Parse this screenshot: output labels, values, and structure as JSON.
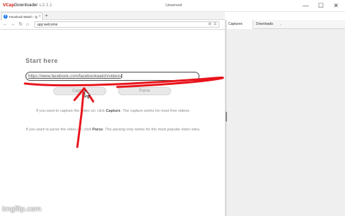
{
  "titlebar": {
    "logo_red": "VCap",
    "logo_rest": "Downloader",
    "version": "v.2.1.1",
    "center_text": "Unserved",
    "minimize_glyph": "—",
    "maximize_glyph": "☐",
    "close_glyph": "✕"
  },
  "tab": {
    "favicon": "f",
    "title": "Facebook Watch - Q...",
    "close_glyph": "×",
    "new_tab_glyph": "+"
  },
  "nav": {
    "back_glyph": "←",
    "forward_glyph": "→",
    "reload_glyph": "↻",
    "home_glyph": "⌂",
    "url": "app:welcome",
    "tools_glyphs": "⊞ ☰"
  },
  "main": {
    "start_title": "Start here",
    "input_value": "https://www.facebook.com/facebookwatch/videos",
    "capture_label": "Capture",
    "parse_label": "Parse",
    "help1_pre": "If you want to capture the video url, click ",
    "help1_bold": "Capture",
    "help1_post": ". The capture works for most free videos.",
    "help2_pre": "If you want to parse the video url, click ",
    "help2_bold": "Parse",
    "help2_post": ". The parsing only works for the most popular video sites."
  },
  "right_pane": {
    "tabs": [
      {
        "label": "Captures"
      },
      {
        "label": "Downloads"
      }
    ],
    "downloads_close_glyph": "×"
  },
  "watermark": "imgflip.com",
  "colors": {
    "annotation_red": "#e8141c",
    "brand_red": "#d8352a",
    "facebook_blue": "#1877f2"
  }
}
